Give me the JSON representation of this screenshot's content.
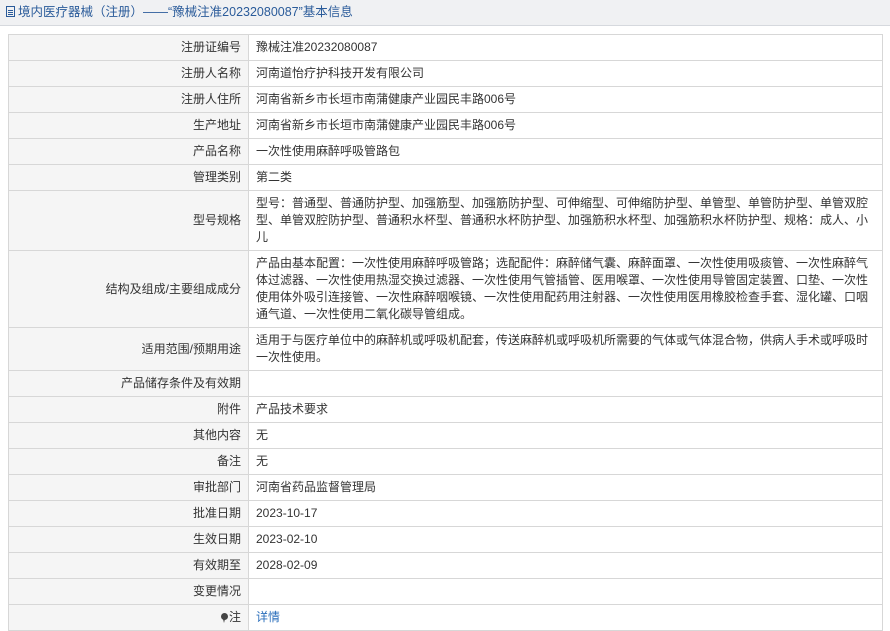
{
  "header": {
    "title": "境内医疗器械（注册）——“豫械注准20232080087”基本信息",
    "icon": "document-icon"
  },
  "rows": [
    {
      "label": "注册证编号",
      "value": "豫械注准20232080087"
    },
    {
      "label": "注册人名称",
      "value": "河南道怡疗护科技开发有限公司"
    },
    {
      "label": "注册人住所",
      "value": "河南省新乡市长垣市南蒲健康产业园民丰路006号"
    },
    {
      "label": "生产地址",
      "value": "河南省新乡市长垣市南蒲健康产业园民丰路006号"
    },
    {
      "label": "产品名称",
      "value": "一次性使用麻醉呼吸管路包"
    },
    {
      "label": "管理类别",
      "value": "第二类"
    },
    {
      "label": "型号规格",
      "value": "型号：普通型、普通防护型、加强筋型、加强筋防护型、可伸缩型、可伸缩防护型、单管型、单管防护型、单管双腔型、单管双腔防护型、普通积水杯型、普通积水杯防护型、加强筋积水杯型、加强筋积水杯防护型、规格：成人、小儿"
    },
    {
      "label": "结构及组成/主要组成成分",
      "value": "产品由基本配置：一次性使用麻醉呼吸管路；选配配件：麻醉储气囊、麻醉面罩、一次性使用吸痰管、一次性麻醉气体过滤器、一次性使用热湿交换过滤器、一次性使用气管插管、医用喉罩、一次性使用导管固定装置、口垫、一次性使用体外吸引连接管、一次性麻醉咽喉镜、一次性使用配药用注射器、一次性使用医用橡胶检查手套、湿化罐、口咽通气道、一次性使用二氧化碳导管组成。"
    },
    {
      "label": "适用范围/预期用途",
      "value": "适用于与医疗单位中的麻醉机或呼吸机配套，传送麻醉机或呼吸机所需要的气体或气体混合物，供病人手术或呼吸时一次性使用。"
    },
    {
      "label": "产品储存条件及有效期",
      "value": ""
    },
    {
      "label": "附件",
      "value": "产品技术要求"
    },
    {
      "label": "其他内容",
      "value": "无"
    },
    {
      "label": "备注",
      "value": "无"
    },
    {
      "label": "审批部门",
      "value": "河南省药品监督管理局"
    },
    {
      "label": "批准日期",
      "value": "2023-10-17"
    },
    {
      "label": "生效日期",
      "value": "2023-02-10"
    },
    {
      "label": "有效期至",
      "value": "2028-02-09"
    },
    {
      "label": "变更情况",
      "value": ""
    }
  ],
  "note_row": {
    "icon": "pin-icon",
    "label": "注",
    "link_text": "详情"
  },
  "colors": {
    "header_text": "#2a5b9a",
    "link": "#2a6ebb",
    "label_bg": "#f5f5f5"
  }
}
